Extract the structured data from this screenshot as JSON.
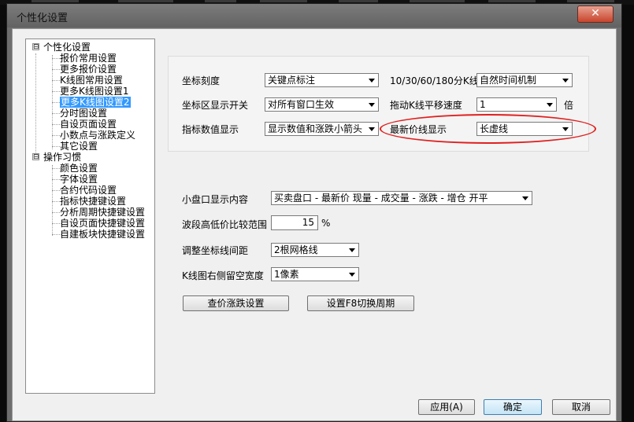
{
  "window": {
    "title": "个性化设置",
    "close_icon": "close-icon"
  },
  "tree": {
    "groups": [
      {
        "label": "个性化设置",
        "expander": "⊟",
        "items": [
          "报价常用设置",
          "更多报价设置",
          "K线图常用设置",
          "更多K线图设置1",
          "更多K线图设置2",
          "分时图设置",
          "自设页面设置",
          "小数点与涨跌定义",
          "其它设置"
        ]
      },
      {
        "label": "操作习惯",
        "expander": "⊟",
        "items": [
          "颜色设置",
          "字体设置",
          "合约代码设置",
          "指标快捷键设置",
          "分析周期快捷键设置",
          "自设页面快捷键设置",
          "自建板块快捷键设置"
        ]
      }
    ],
    "selected": "更多K线图设置2"
  },
  "settings": {
    "axis_scale": {
      "label": "坐标刻度",
      "value": "关键点标注"
    },
    "kline_mech": {
      "label": "10/30/60/180分K线",
      "value": "自然时间机制"
    },
    "axis_switch": {
      "label": "坐标区显示开关",
      "value": "对所有窗口生效"
    },
    "drag_speed": {
      "label": "拖动K线平移速度",
      "value": "1",
      "unit": "倍"
    },
    "indicator_display": {
      "label": "指标数值显示",
      "value": "显示数值和涨跌小箭头"
    },
    "latest_price_line": {
      "label": "最新价线显示",
      "value": "长虚线"
    },
    "small_panel": {
      "label": "小盘口显示内容",
      "value": "买卖盘口 - 最新价 现量 - 成交量 - 涨跌 - 增仓 开平"
    },
    "wave_range": {
      "label": "波段高低价比较范围",
      "value": "15",
      "unit": "%"
    },
    "grid_spacing": {
      "label": "调整坐标线间距",
      "value": "2根网格线"
    },
    "right_margin": {
      "label": "K线图右侧留空宽度",
      "value": "1像素"
    }
  },
  "buttons": {
    "price_change": "查价涨跌设置",
    "f8_cycle": "设置F8切换周期",
    "apply": "应用(A)",
    "ok": "确定",
    "cancel": "取消"
  },
  "colors": {
    "highlight": "#3399ff",
    "annotation_circle": "#e02020"
  }
}
